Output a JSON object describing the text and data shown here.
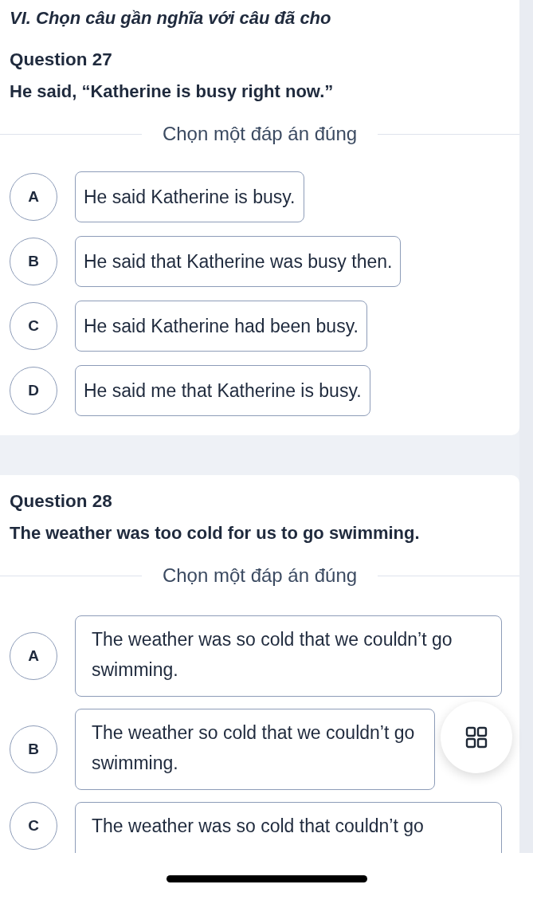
{
  "section_title": "VI. Chọn câu gần nghĩa với câu đã cho",
  "questions": [
    {
      "number": "Question 27",
      "prompt": "He said, “Katherine is busy right now.”",
      "instruction": "Chọn một đáp án đúng",
      "options": [
        {
          "letter": "A",
          "text": "He said Katherine is busy."
        },
        {
          "letter": "B",
          "text": "He said that Katherine was busy then."
        },
        {
          "letter": "C",
          "text": "He said Katherine had been busy."
        },
        {
          "letter": "D",
          "text": "He said me that Katherine is busy."
        }
      ]
    },
    {
      "number": "Question 28",
      "prompt": "The weather was too cold for us to go swimming.",
      "instruction": "Chọn một đáp án đúng",
      "options": [
        {
          "letter": "A",
          "text": "The weather was so cold that we couldn’t go swimming."
        },
        {
          "letter": "B",
          "text": "The weather so cold that we couldn’t go swimming."
        },
        {
          "letter": "C",
          "text": "The weather was so cold that couldn’t go"
        }
      ]
    }
  ]
}
